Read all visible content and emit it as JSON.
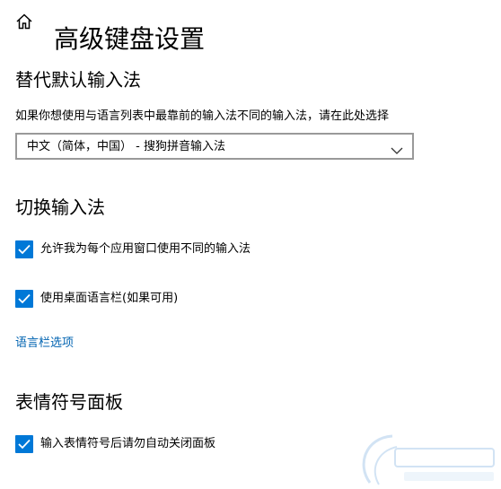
{
  "header": {
    "title": "高级键盘设置",
    "home_icon": "home-icon"
  },
  "override_input": {
    "heading": "替代默认输入法",
    "description": "如果你想使用与语言列表中最靠前的输入法不同的输入法，请在此处选择",
    "dropdown_value": "中文（简体，中国） - 搜狗拼音输入法"
  },
  "switch_input": {
    "heading": "切换输入法",
    "options": [
      {
        "label": "允许我为每个应用窗口使用不同的输入法",
        "checked": true
      },
      {
        "label": "使用桌面语言栏(如果可用)",
        "checked": true
      }
    ],
    "link": "语言栏选项"
  },
  "emoji_panel": {
    "heading": "表情符号面板",
    "options": [
      {
        "label": "输入表情符号后请勿自动关闭面板",
        "checked": true
      }
    ]
  },
  "colors": {
    "accent": "#0078d7",
    "link": "#0063b1"
  }
}
